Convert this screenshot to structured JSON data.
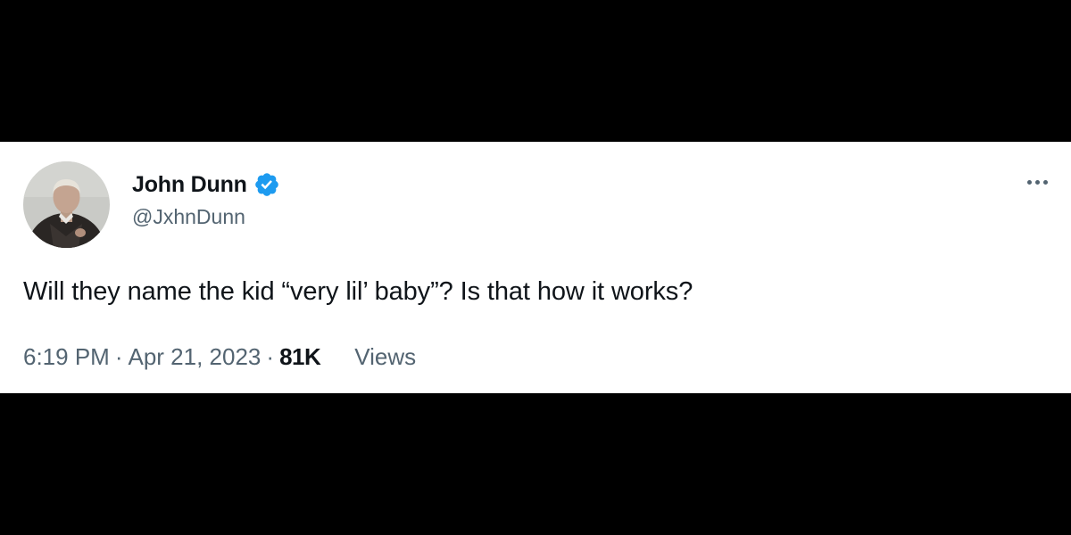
{
  "tweet": {
    "author": {
      "display_name": "John Dunn",
      "handle": "@JxhnDunn",
      "verified": true,
      "avatar_icon": "profile-photo"
    },
    "text": "Will they name the kid “very lil’ baby”?  Is that how it works?",
    "time": "6:19 PM",
    "separator": "·",
    "date": "Apr 21, 2023",
    "views_count": "81K",
    "views_label": "Views",
    "more_icon": "more-horizontal-icon"
  },
  "colors": {
    "background": "#000000",
    "card": "#ffffff",
    "primary_text": "#0f1419",
    "secondary_text": "#536471",
    "verified_badge": "#1d9bf0"
  }
}
